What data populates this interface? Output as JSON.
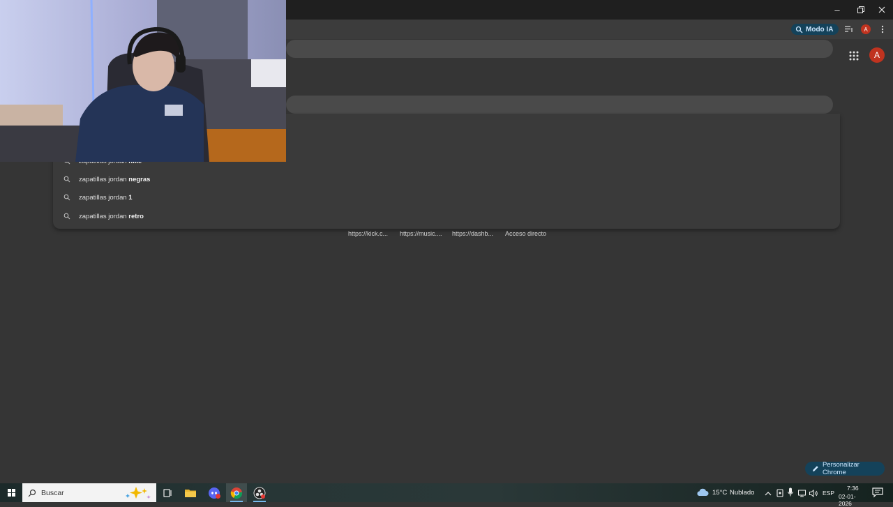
{
  "browser": {
    "modo_ia_label": "Modo IA",
    "profile_initial": "A",
    "customize_label": "Personalizar Chrome"
  },
  "omnibox": {
    "suggestions": [
      {
        "prefix": "zapatillas jordan ",
        "bold": "nike"
      },
      {
        "prefix": "zapatillas jordan ",
        "bold": "negras"
      },
      {
        "prefix": "zapatillas jordan ",
        "bold": "1"
      },
      {
        "prefix": "zapatillas jordan ",
        "bold": "retro"
      }
    ]
  },
  "shortcuts": [
    {
      "label": "https://kick.c..."
    },
    {
      "label": "https://music...."
    },
    {
      "label": "https://dashb..."
    },
    {
      "label": "Acceso directo"
    }
  ],
  "taskbar": {
    "search_placeholder": "Buscar",
    "weather_temp": "15°C",
    "weather_desc": "Nublado",
    "language": "ESP",
    "time": "7:36",
    "date": "02-01-2026",
    "apps": [
      "task-view",
      "file-explorer",
      "discord",
      "chrome",
      "obs-studio"
    ]
  },
  "colors": {
    "page_bg": "#353535",
    "accent_chip": "#14425a",
    "avatar": "#c0331f"
  }
}
